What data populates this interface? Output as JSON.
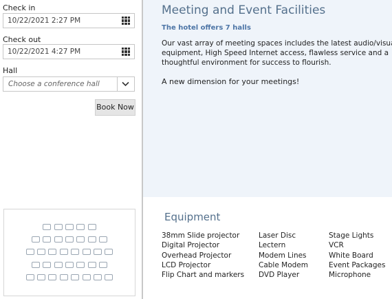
{
  "booking": {
    "check_in_label": "Check in",
    "check_in_value": "10/22/2021 2:27 PM",
    "check_out_label": "Check out",
    "check_out_value": "10/22/2021 4:27 PM",
    "hall_label": "Hall",
    "hall_placeholder": "Choose a conference hall",
    "book_button": "Book Now"
  },
  "hall_map": {
    "rows": [
      5,
      7,
      8,
      7,
      8
    ]
  },
  "facilities": {
    "title": "Meeting and Event Facilities",
    "subtitle": "The hotel offers 7 halls",
    "paragraph": "Our vast array of meeting spaces includes the latest audio/visual equipment, High Speed Internet access, flawless service and a thoughtful environment for success to flourish.",
    "tagline": "A new dimension for your meetings!"
  },
  "equipment": {
    "title": "Equipment",
    "columns": [
      [
        "38mm Slide projector",
        "Digital Projector",
        "Overhead Projector",
        "LCD Projector",
        "Flip Chart and markers"
      ],
      [
        "Laser Disc",
        "Lectern",
        "Modem Lines",
        "Cable Modem",
        "DVD Player"
      ],
      [
        "Stage Lights",
        "VCR",
        "White Board",
        "Event Packages",
        "Microphone"
      ]
    ]
  }
}
